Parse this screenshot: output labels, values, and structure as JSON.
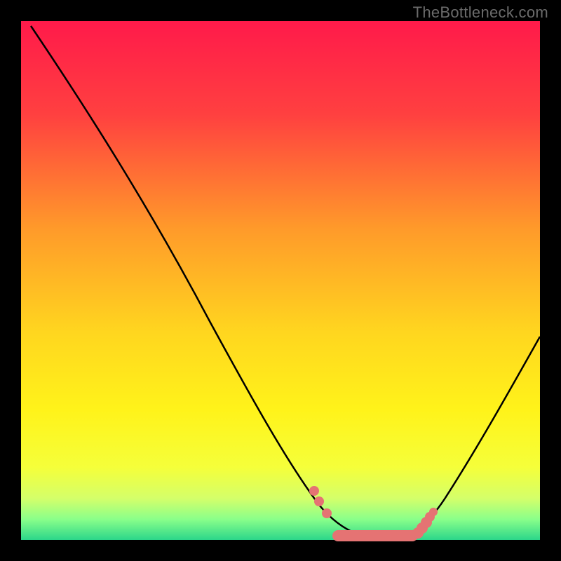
{
  "watermark": "TheBottleneck.com",
  "chart_data": {
    "type": "line",
    "title": "",
    "xlabel": "",
    "ylabel": "",
    "xlim": [
      0,
      100
    ],
    "ylim": [
      0,
      100
    ],
    "background_gradient": {
      "stops": [
        {
          "offset": 0.0,
          "color": "#ff1a4a"
        },
        {
          "offset": 0.18,
          "color": "#ff4040"
        },
        {
          "offset": 0.4,
          "color": "#ff9a2a"
        },
        {
          "offset": 0.6,
          "color": "#ffd61f"
        },
        {
          "offset": 0.75,
          "color": "#fff31a"
        },
        {
          "offset": 0.86,
          "color": "#f5ff3a"
        },
        {
          "offset": 0.92,
          "color": "#d4ff6a"
        },
        {
          "offset": 0.96,
          "color": "#8aff8a"
        },
        {
          "offset": 1.0,
          "color": "#2bd68a"
        }
      ]
    },
    "series": [
      {
        "name": "bottleneck-curve",
        "type": "line",
        "color": "#000000",
        "x": [
          2,
          10,
          18,
          26,
          34,
          42,
          50,
          55,
          58,
          62,
          66,
          70,
          74,
          78,
          82,
          88,
          94,
          100
        ],
        "y": [
          99,
          88,
          76,
          64,
          51,
          38,
          24,
          14,
          8,
          3,
          1,
          0.5,
          0.5,
          1,
          4,
          12,
          24,
          40
        ]
      },
      {
        "name": "optimal-band-markers",
        "type": "scatter",
        "color": "#e57373",
        "x": [
          56,
          57,
          60,
          63,
          66,
          69,
          72,
          75,
          77,
          78
        ],
        "y": [
          10,
          8,
          4,
          2.5,
          1.5,
          1,
          1,
          1.5,
          2.5,
          4
        ]
      }
    ],
    "annotations": []
  }
}
